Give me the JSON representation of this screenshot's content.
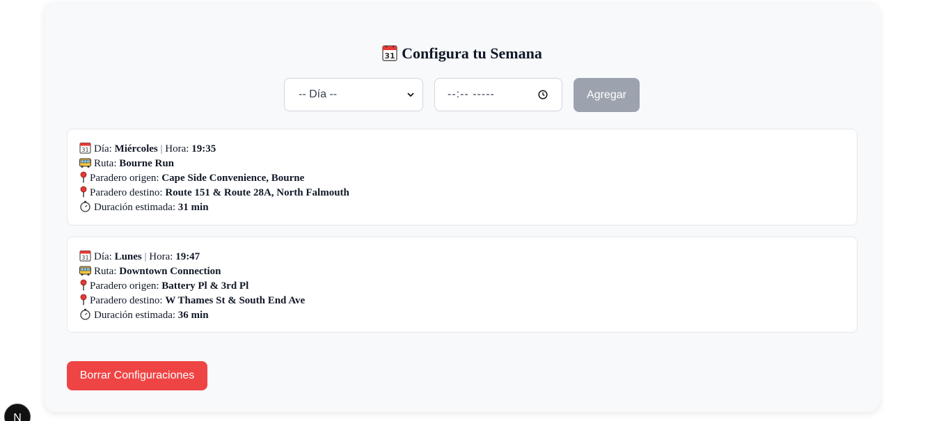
{
  "header": {
    "title": "Configura tu Semana",
    "title_icon": "calendar-icon"
  },
  "form": {
    "day_select_value": "-- Día --",
    "time_input_value": "--:--  -----",
    "add_button_label": "Agregar"
  },
  "labels": {
    "day": "Día:",
    "separator": "|",
    "hour": "Hora:",
    "route": "Ruta:",
    "origin": "Paradero origen:",
    "destination": "Paradero destino:",
    "duration": "Duración estimada:"
  },
  "configs": [
    {
      "day": "Miércoles",
      "hour": "19:35",
      "route": "Bourne Run",
      "origin": "Cape Side Convenience, Bourne",
      "destination": "Route 151 & Route 28A, North Falmouth",
      "duration": "31 min"
    },
    {
      "day": "Lunes",
      "hour": "19:47",
      "route": "Downtown Connection",
      "origin": "Battery Pl & 3rd Pl",
      "destination": "W Thames St & South End Ave",
      "duration": "36 min"
    }
  ],
  "clear_button_label": "Borrar Configuraciones",
  "badge_letter": "N",
  "colors": {
    "add_button": "#9ca3af",
    "clear_button": "#ef4444",
    "panel_bg": "#f8f9fb"
  }
}
